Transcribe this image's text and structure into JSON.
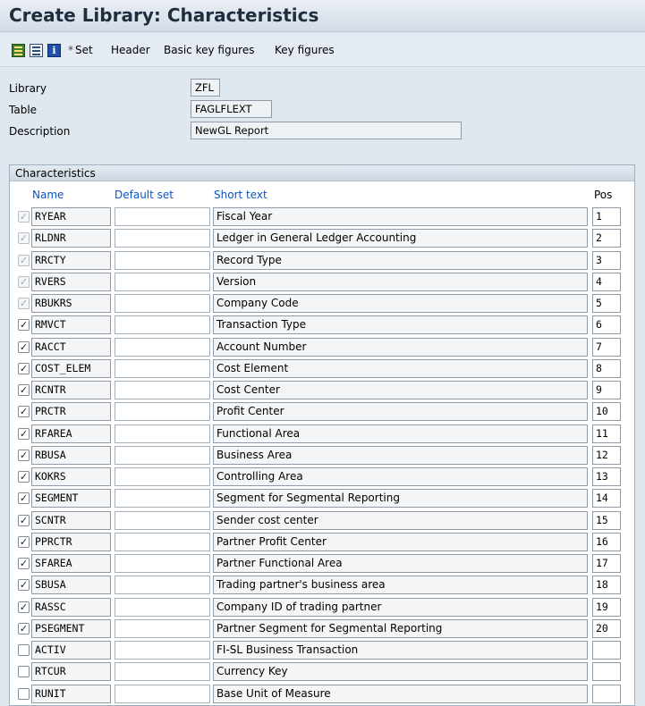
{
  "title": "Create Library: Characteristics",
  "toolbar": {
    "icons": [
      "display-change-icon",
      "list-icon",
      "info-icon"
    ],
    "set_label": "Set",
    "header_label": "Header",
    "basic_kf_label": "Basic key figures",
    "kf_label": "Key figures"
  },
  "form": {
    "library_label": "Library",
    "library_value": "ZFL",
    "table_label": "Table",
    "table_value": "FAGLFLEXT",
    "description_label": "Description",
    "description_value": "NewGL Report"
  },
  "characteristics": {
    "section_title": "Characteristics",
    "col_name": "Name",
    "col_default": "Default set",
    "col_short": "Short text",
    "col_pos": "Pos",
    "rows": [
      {
        "name": "RYEAR",
        "short": "Fiscal Year",
        "pos": "1",
        "checked": true,
        "disabled": true
      },
      {
        "name": "RLDNR",
        "short": "Ledger in General Ledger Accounting",
        "pos": "2",
        "checked": true,
        "disabled": true
      },
      {
        "name": "RRCTY",
        "short": "Record Type",
        "pos": "3",
        "checked": true,
        "disabled": true
      },
      {
        "name": "RVERS",
        "short": "Version",
        "pos": "4",
        "checked": true,
        "disabled": true
      },
      {
        "name": "RBUKRS",
        "short": "Company Code",
        "pos": "5",
        "checked": true,
        "disabled": true
      },
      {
        "name": "RMVCT",
        "short": "Transaction Type",
        "pos": "6",
        "checked": true,
        "disabled": false
      },
      {
        "name": "RACCT",
        "short": "Account Number",
        "pos": "7",
        "checked": true,
        "disabled": false
      },
      {
        "name": "COST_ELEM",
        "short": "Cost Element",
        "pos": "8",
        "checked": true,
        "disabled": false
      },
      {
        "name": "RCNTR",
        "short": "Cost Center",
        "pos": "9",
        "checked": true,
        "disabled": false
      },
      {
        "name": "PRCTR",
        "short": "Profit Center",
        "pos": "10",
        "checked": true,
        "disabled": false
      },
      {
        "name": "RFAREA",
        "short": "Functional Area",
        "pos": "11",
        "checked": true,
        "disabled": false
      },
      {
        "name": "RBUSA",
        "short": "Business Area",
        "pos": "12",
        "checked": true,
        "disabled": false
      },
      {
        "name": "KOKRS",
        "short": "Controlling Area",
        "pos": "13",
        "checked": true,
        "disabled": false
      },
      {
        "name": "SEGMENT",
        "short": "Segment for Segmental Reporting",
        "pos": "14",
        "checked": true,
        "disabled": false
      },
      {
        "name": "SCNTR",
        "short": "Sender cost center",
        "pos": "15",
        "checked": true,
        "disabled": false
      },
      {
        "name": "PPRCTR",
        "short": "Partner Profit Center",
        "pos": "16",
        "checked": true,
        "disabled": false
      },
      {
        "name": "SFAREA",
        "short": "Partner Functional Area",
        "pos": "17",
        "checked": true,
        "disabled": false
      },
      {
        "name": "SBUSA",
        "short": "Trading partner's business area",
        "pos": "18",
        "checked": true,
        "disabled": false
      },
      {
        "name": "RASSC",
        "short": "Company ID of trading partner",
        "pos": "19",
        "checked": true,
        "disabled": false
      },
      {
        "name": "PSEGMENT",
        "short": "Partner Segment for Segmental Reporting",
        "pos": "20",
        "checked": true,
        "disabled": false
      },
      {
        "name": "ACTIV",
        "short": "FI-SL Business Transaction",
        "pos": "",
        "checked": false,
        "disabled": false
      },
      {
        "name": "RTCUR",
        "short": "Currency Key",
        "pos": "",
        "checked": false,
        "disabled": false
      },
      {
        "name": "RUNIT",
        "short": "Base Unit of Measure",
        "pos": "",
        "checked": false,
        "disabled": false
      }
    ]
  }
}
